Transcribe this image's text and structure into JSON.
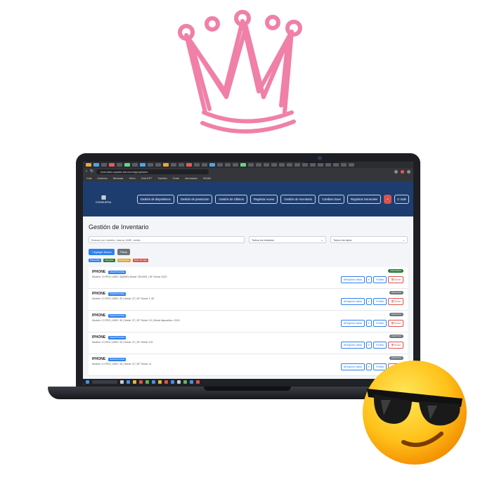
{
  "browser": {
    "url": "inventario.asplan-bal.com/app/gestion",
    "bookmarks": [
      "Chat",
      "Gobierno",
      "Bienestar",
      "Oficio",
      "Chat GPT",
      "Tramites",
      "Portal",
      "Informacion",
      "SIGAN"
    ]
  },
  "app": {
    "logo_text": "CONSEJERIA",
    "nav": [
      "Gestión de dispositivos",
      "Gestión de prestacion",
      "Gestión de Últimos",
      "Registrar nuevo",
      "Gestión de Inventario",
      "Cambiar clave",
      "Registros Generales"
    ],
    "salir_label": "Salir"
  },
  "page": {
    "title": "Gestión de Inventario",
    "search_placeholder": "Buscar por modelo, marca, IMEI, serial...",
    "status_select": "Todos los estados",
    "type_select": "Todos los tipos",
    "btn_add": "+ Agregar Nuevo",
    "btn_filters": "Filtros",
    "legend": [
      {
        "label": "Disponible",
        "color": "#2f80ed"
      },
      {
        "label": "Asignado",
        "color": "#1e7e34"
      },
      {
        "label": "Reparación",
        "color": "#e0a82e"
      },
      {
        "label": "Dado de baja",
        "color": "#d9534f"
      }
    ]
  },
  "devices": [
    {
      "name": "IPHONE",
      "type": "SMARTPHONE",
      "meta": "Modelo: 13 PRO | IMEI: 35(IMEI) Serial: 3910001 | SF Serial: 2022",
      "status": "ASIGNADO",
      "status_color": "green"
    },
    {
      "name": "IPHONE",
      "type": "SMARTPHONE",
      "meta": "Modelo: 13 PRO | IMEI: 35 | Serial: 37 | SF Serial: 1 VE",
      "status": "INACTIVO",
      "status_color": "gray"
    },
    {
      "name": "IPHONE",
      "type": "SMARTPHONE",
      "meta": "Modelo: 13 PRO | IMEI: 35 | Serial: 37 | SF Serial: 15 | Serial dispositivo: 2024",
      "status": "INACTIVO",
      "status_color": "gray"
    },
    {
      "name": "IPHONE",
      "type": "SMARTPHONE",
      "meta": "Modelo: 13 PRO | IMEI: 35 | Serial: 37 | SF Serial: 101",
      "status": "INACTIVO",
      "status_color": "gray"
    },
    {
      "name": "IPHONE",
      "type": "SMARTPHONE",
      "meta": "Modelo: 13 PRO | IMEI: 35 | Serial: 37 | SF Serial: 11",
      "status": "INACTIVO",
      "status_color": "gray"
    }
  ],
  "row_actions": {
    "assign": "Registrar salida",
    "edit": "Editar",
    "delete": "Borrar"
  }
}
